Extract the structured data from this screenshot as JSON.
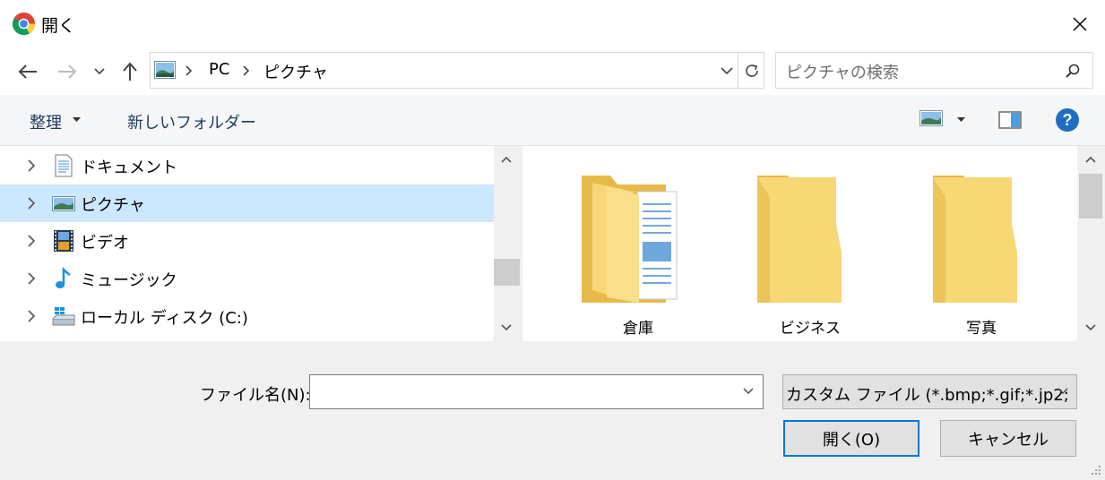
{
  "window": {
    "title": "開く"
  },
  "address": {
    "crumbs": [
      "PC",
      "ピクチャ"
    ]
  },
  "search": {
    "placeholder": "ピクチャの検索"
  },
  "commands": {
    "organize": "整理",
    "new_folder": "新しいフォルダー"
  },
  "nav_pane": {
    "items": [
      {
        "label": "ドキュメント",
        "icon": "document-icon",
        "selected": false
      },
      {
        "label": "ピクチャ",
        "icon": "pictures-icon",
        "selected": true
      },
      {
        "label": "ビデオ",
        "icon": "video-icon",
        "selected": false
      },
      {
        "label": "ミュージック",
        "icon": "music-icon",
        "selected": false
      },
      {
        "label": "ローカル ディスク (C:)",
        "icon": "drive-icon",
        "selected": false
      }
    ]
  },
  "content": {
    "folders": [
      {
        "name": "倉庫",
        "icon": "folder-with-documents-icon"
      },
      {
        "name": "ビジネス",
        "icon": "folder-icon"
      },
      {
        "name": "写真",
        "icon": "folder-icon"
      }
    ]
  },
  "footer": {
    "filename_label": "ファイル名(N):",
    "filename_value": "",
    "filter_value": "カスタム ファイル (*.bmp;*.gif;*.jp2;",
    "open_button": "開く(O)",
    "cancel_button": "キャンセル"
  },
  "colors": {
    "selected_bg": "#cce8ff",
    "accent": "#0078d7",
    "folder": "#f8d775",
    "help": "#1f6dc2"
  }
}
